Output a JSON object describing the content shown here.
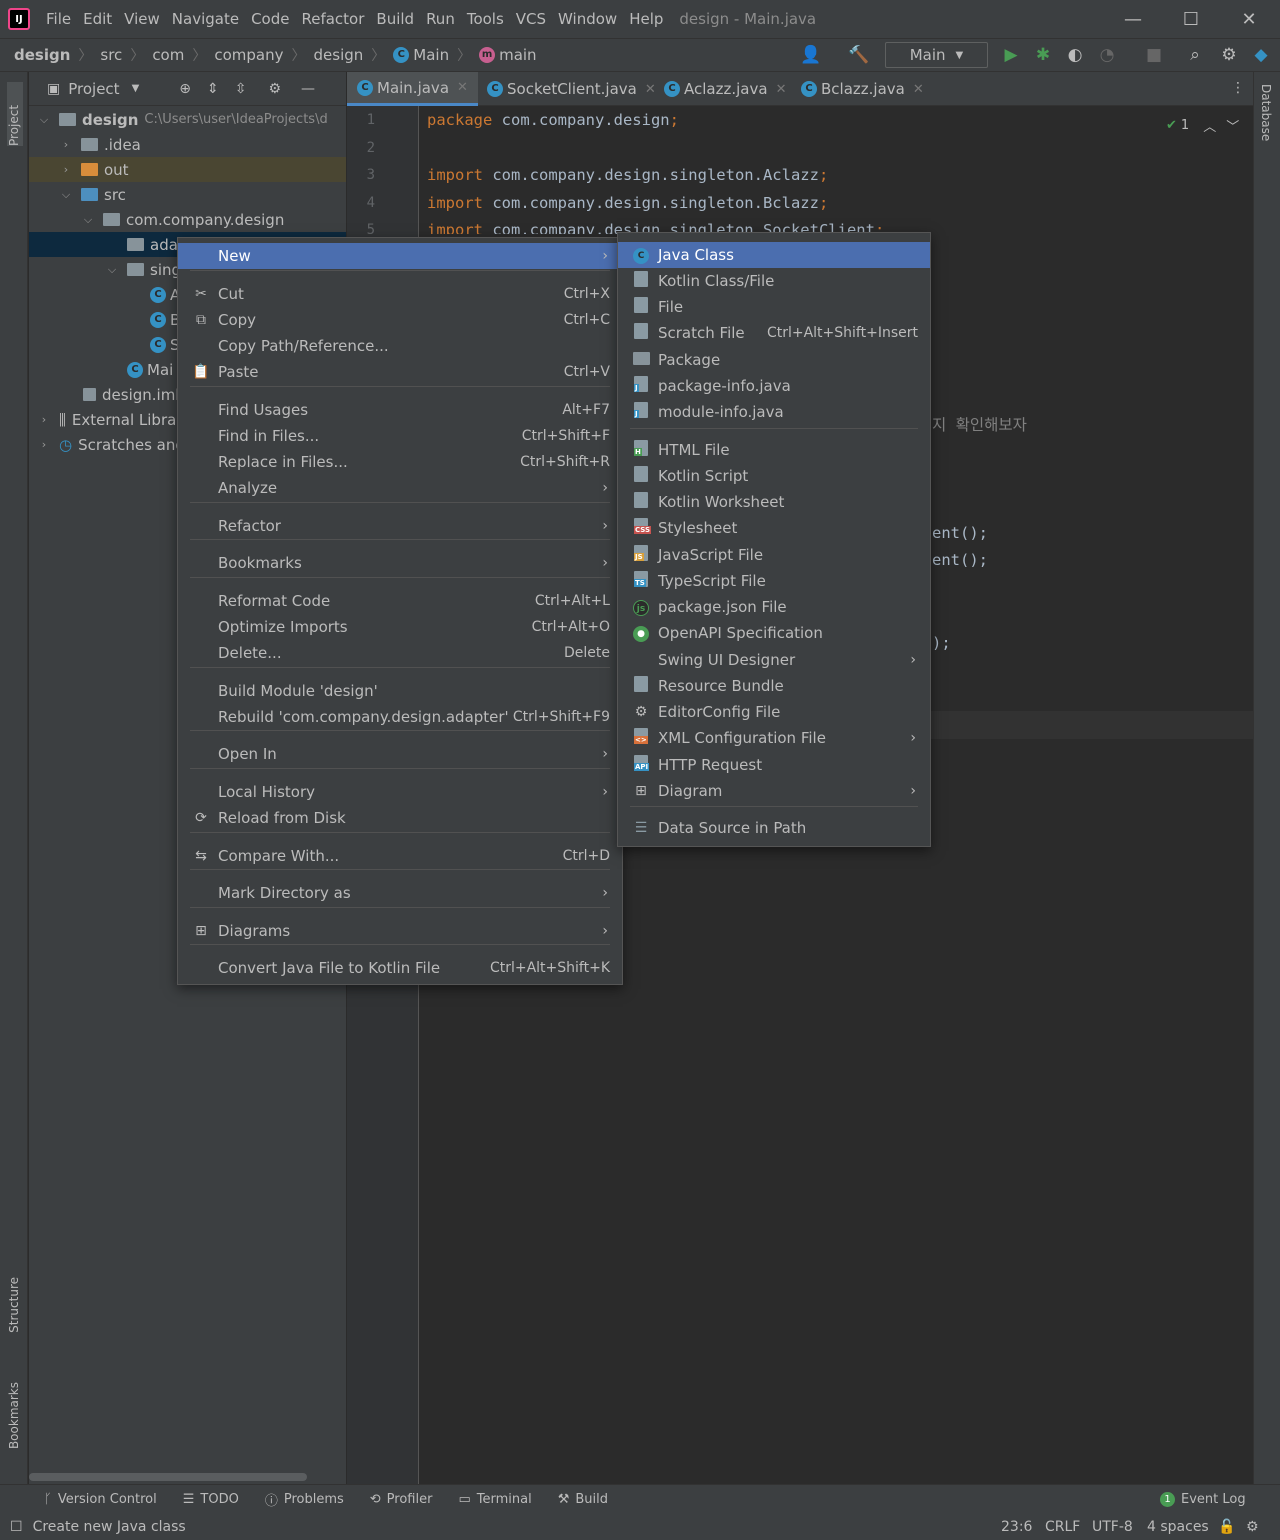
{
  "titlebar": {
    "menu": [
      "File",
      "Edit",
      "View",
      "Navigate",
      "Code",
      "Refactor",
      "Build",
      "Run",
      "Tools",
      "VCS",
      "Window",
      "Help"
    ],
    "window_title": "design - Main.java",
    "minimize_glyph": "—",
    "maximize_glyph": "☐",
    "close_glyph": "✕"
  },
  "breadcrumb": [
    "design",
    "src",
    "com",
    "company",
    "design",
    "Main",
    "main"
  ],
  "toolbar": {
    "run_config": "Main"
  },
  "project_panel": {
    "title": "Project",
    "root_name": "design",
    "root_path": "C:\\Users\\user\\IdeaProjects\\d",
    "items": [
      {
        "label": ".idea"
      },
      {
        "label": "out"
      },
      {
        "label": "src"
      },
      {
        "label": "com.company.design"
      },
      {
        "label": "adap"
      },
      {
        "label": "sing"
      },
      {
        "label": "A"
      },
      {
        "label": "B"
      },
      {
        "label": "S"
      },
      {
        "label": "Mai"
      },
      {
        "label": "design.iml"
      },
      {
        "label": "External Librar"
      },
      {
        "label": "Scratches and"
      }
    ]
  },
  "editor_tabs": [
    {
      "label": "Main.java"
    },
    {
      "label": "SocketClient.java"
    },
    {
      "label": "Aclazz.java"
    },
    {
      "label": "Bclazz.java"
    }
  ],
  "left_strip": {
    "project": "Project",
    "structure": "Structure",
    "bookmarks": "Bookmarks"
  },
  "right_strip": {
    "database": "Database"
  },
  "editor": {
    "line_numbers": [
      "1",
      "2",
      "3",
      "4",
      "5"
    ],
    "lines": [
      {
        "kw": "package",
        "rest": " com.company.design",
        "semi": ";"
      },
      {
        "kw": "",
        "rest": "",
        "semi": ""
      },
      {
        "kw": "import",
        "rest": " com.company.design.singleton.Aclazz",
        "semi": ";"
      },
      {
        "kw": "import",
        "rest": " com.company.design.singleton.Bclazz",
        "semi": ";"
      },
      {
        "kw": "import",
        "rest": " com.company.design.singleton.SocketClient",
        "semi": ";"
      }
    ],
    "korean_comment": "지 확인해보자",
    "frag1": "ent();",
    "frag2": "ent();",
    "frag3": ");",
    "inspection_count": "1"
  },
  "context_menu": {
    "items": [
      {
        "label": "New",
        "shortcut": "",
        "submenu": true,
        "icon": ""
      },
      {
        "label": "Cut",
        "shortcut": "Ctrl+X",
        "icon": "✂"
      },
      {
        "label": "Copy",
        "shortcut": "Ctrl+C",
        "icon": "⧉"
      },
      {
        "label": "Copy Path/Reference...",
        "shortcut": "",
        "icon": ""
      },
      {
        "label": "Paste",
        "shortcut": "Ctrl+V",
        "icon": "📋"
      },
      {
        "label": "Find Usages",
        "shortcut": "Alt+F7",
        "icon": ""
      },
      {
        "label": "Find in Files...",
        "shortcut": "Ctrl+Shift+F",
        "icon": ""
      },
      {
        "label": "Replace in Files...",
        "shortcut": "Ctrl+Shift+R",
        "icon": ""
      },
      {
        "label": "Analyze",
        "shortcut": "",
        "submenu": true,
        "icon": ""
      },
      {
        "label": "Refactor",
        "shortcut": "",
        "submenu": true,
        "icon": ""
      },
      {
        "label": "Bookmarks",
        "shortcut": "",
        "submenu": true,
        "icon": ""
      },
      {
        "label": "Reformat Code",
        "shortcut": "Ctrl+Alt+L",
        "icon": ""
      },
      {
        "label": "Optimize Imports",
        "shortcut": "Ctrl+Alt+O",
        "icon": ""
      },
      {
        "label": "Delete...",
        "shortcut": "Delete",
        "icon": ""
      },
      {
        "label": "Build Module 'design'",
        "shortcut": "",
        "icon": ""
      },
      {
        "label": "Rebuild 'com.company.design.adapter'",
        "shortcut": "Ctrl+Shift+F9",
        "icon": ""
      },
      {
        "label": "Open In",
        "shortcut": "",
        "submenu": true,
        "icon": ""
      },
      {
        "label": "Local History",
        "shortcut": "",
        "submenu": true,
        "icon": ""
      },
      {
        "label": "Reload from Disk",
        "shortcut": "",
        "icon": "⟳"
      },
      {
        "label": "Compare With...",
        "shortcut": "Ctrl+D",
        "icon": "⇆"
      },
      {
        "label": "Mark Directory as",
        "shortcut": "",
        "submenu": true,
        "icon": ""
      },
      {
        "label": "Diagrams",
        "shortcut": "",
        "submenu": true,
        "icon": "⊞"
      },
      {
        "label": "Convert Java File to Kotlin File",
        "shortcut": "Ctrl+Alt+Shift+K",
        "icon": ""
      }
    ]
  },
  "new_submenu": {
    "items": [
      {
        "label": "Java Class",
        "shortcut": ""
      },
      {
        "label": "Kotlin Class/File",
        "shortcut": ""
      },
      {
        "label": "File",
        "shortcut": ""
      },
      {
        "label": "Scratch File",
        "shortcut": "Ctrl+Alt+Shift+Insert"
      },
      {
        "label": "Package",
        "shortcut": ""
      },
      {
        "label": "package-info.java",
        "shortcut": ""
      },
      {
        "label": "module-info.java",
        "shortcut": ""
      },
      {
        "label": "HTML File",
        "shortcut": ""
      },
      {
        "label": "Kotlin Script",
        "shortcut": ""
      },
      {
        "label": "Kotlin Worksheet",
        "shortcut": ""
      },
      {
        "label": "Stylesheet",
        "shortcut": ""
      },
      {
        "label": "JavaScript File",
        "shortcut": ""
      },
      {
        "label": "TypeScript File",
        "shortcut": ""
      },
      {
        "label": "package.json File",
        "shortcut": ""
      },
      {
        "label": "OpenAPI Specification",
        "shortcut": ""
      },
      {
        "label": "Swing UI Designer",
        "shortcut": "",
        "submenu": true
      },
      {
        "label": "Resource Bundle",
        "shortcut": ""
      },
      {
        "label": "EditorConfig File",
        "shortcut": ""
      },
      {
        "label": "XML Configuration File",
        "shortcut": "",
        "submenu": true
      },
      {
        "label": "HTTP Request",
        "shortcut": ""
      },
      {
        "label": "Diagram",
        "shortcut": "",
        "submenu": true
      },
      {
        "label": "Data Source in Path",
        "shortcut": ""
      }
    ]
  },
  "tool_windows": [
    "Version Control",
    "TODO",
    "Problems",
    "Profiler",
    "Terminal",
    "Build"
  ],
  "event_log": {
    "count": "1",
    "label": "Event Log"
  },
  "status": {
    "message": "Create new Java class",
    "position": "23:6",
    "line_sep": "CRLF",
    "encoding": "UTF-8",
    "indent": "4 spaces"
  },
  "colors": {
    "highlight": "#4b6eaf",
    "keyword": "#cc7832",
    "run_green": "#499c54"
  }
}
